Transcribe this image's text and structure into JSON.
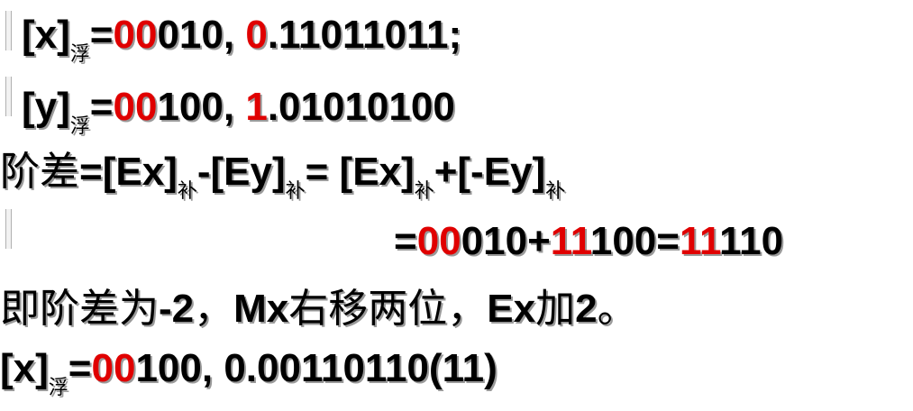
{
  "colors": {
    "text": "#000000",
    "highlight": "#e00000",
    "shadow": "#9a9a9a"
  },
  "lines": [
    {
      "id": "x-float",
      "segments": [
        {
          "t": "[x]"
        },
        {
          "t": "浮",
          "sub": true
        },
        {
          "t": "="
        },
        {
          "t": "00",
          "red": true
        },
        {
          "t": "010, "
        },
        {
          "t": "0",
          "red": true
        },
        {
          "t": ".11011011;"
        }
      ]
    },
    {
      "id": "y-float",
      "segments": [
        {
          "t": "[y]"
        },
        {
          "t": "浮",
          "sub": true
        },
        {
          "t": "="
        },
        {
          "t": "00",
          "red": true
        },
        {
          "t": "100, "
        },
        {
          "t": "1",
          "red": true
        },
        {
          "t": ".01010100"
        }
      ]
    },
    {
      "id": "exponent-diff",
      "segments": [
        {
          "t": "阶差",
          "cjk": true
        },
        {
          "t": "=[Ex]"
        },
        {
          "t": "补",
          "sub": true
        },
        {
          "t": "-[Ey]"
        },
        {
          "t": "补",
          "sub": true
        },
        {
          "t": "= [Ex]"
        },
        {
          "t": "补",
          "sub": true
        },
        {
          "t": "+[-Ey]"
        },
        {
          "t": "补",
          "sub": true
        }
      ]
    },
    {
      "id": "exponent-calc",
      "segments": [
        {
          "t": "="
        },
        {
          "t": "00",
          "red": true
        },
        {
          "t": "010+"
        },
        {
          "t": "11",
          "red": true
        },
        {
          "t": "100="
        },
        {
          "t": "11",
          "red": true
        },
        {
          "t": "110"
        }
      ]
    },
    {
      "id": "align-note",
      "segments": [
        {
          "t": "即阶差为",
          "cjk": true
        },
        {
          "t": "-2"
        },
        {
          "t": "，",
          "cjk": true
        },
        {
          "t": "Mx"
        },
        {
          "t": "右移两位",
          "cjk": true
        },
        {
          "t": "，",
          "cjk": true
        },
        {
          "t": "Ex"
        },
        {
          "t": "加",
          "cjk": true
        },
        {
          "t": "2"
        },
        {
          "t": "。",
          "cjk": true
        }
      ]
    },
    {
      "id": "x-float-aligned",
      "segments": [
        {
          "t": "[x]"
        },
        {
          "t": "浮",
          "sub": true
        },
        {
          "t": "="
        },
        {
          "t": "00",
          "red": true
        },
        {
          "t": "100, 0.00110110(11)"
        }
      ]
    }
  ]
}
